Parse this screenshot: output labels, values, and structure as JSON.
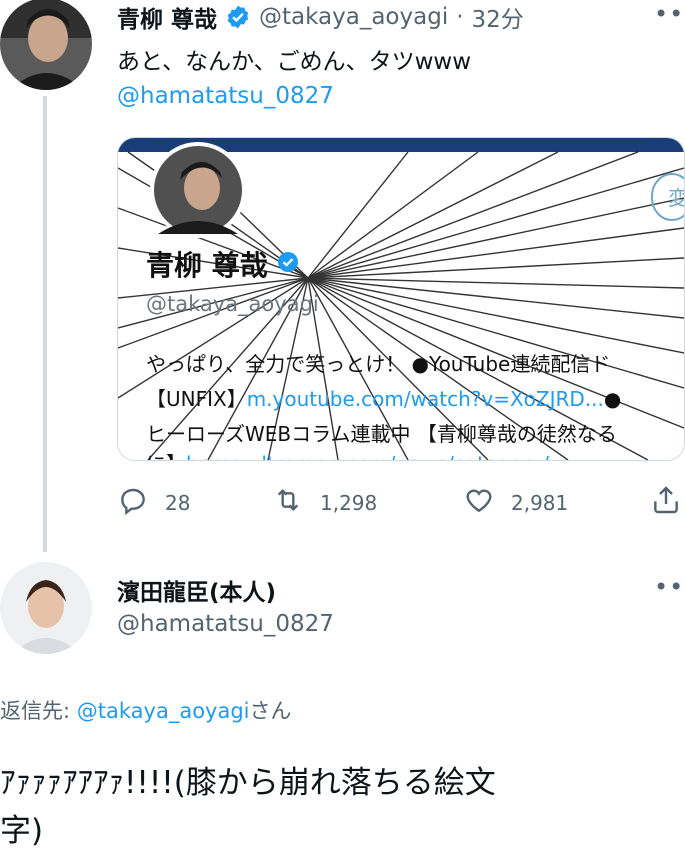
{
  "tweet1": {
    "name": "青柳 尊哉",
    "handle": "@takaya_aoyagi",
    "dot": "·",
    "time": "32分",
    "text": "あと、なんか、ごめん、タツwww",
    "mention": "@hamatatsu_0827",
    "card": {
      "profile_name": "青柳 尊哉",
      "profile_handle": "@takaya_aoyagi",
      "button_label": "変",
      "bio_line1": "やっぱり、全力で笑っとけ！ ●YouTube連続配信ド",
      "bio_line2_prefix": "【UNFIX】",
      "bio_line2_link": "m.youtube.com/watch?v=XoZJRD...",
      "bio_line2_suffix": "●",
      "bio_line3": "ヒーローズWEBコラム連載中 【青柳尊哉の徒然なる",
      "bio_line4_prefix": "に】",
      "bio_line4_link": "heros-ultraman.com/news/category/..."
    },
    "actions": {
      "replies": "28",
      "retweets": "1,298",
      "likes": "2,981"
    }
  },
  "tweet2": {
    "name": "濱田龍臣(本人)",
    "handle": "@hamatatsu_0827",
    "reply_prefix": "返信先: ",
    "reply_to": "@takaya_aoyagi",
    "reply_suffix": "さん",
    "text_line1": "ｱｧｧｧｱｱｱｧ!!!!(膝から崩れ落ちる絵文",
    "text_line2": "字)"
  },
  "colors": {
    "accent": "#1d9bf0",
    "secondary_text": "#536471",
    "border": "#cfd9de"
  }
}
